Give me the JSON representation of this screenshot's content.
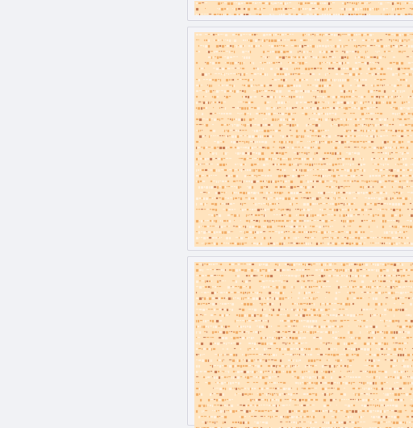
{
  "colors": {
    "page_background": "#f1f2f5",
    "card_background": "#f4f4f8",
    "card_border": "#d9d9e2",
    "tile_background": "#ffe3bd",
    "glyph_warm": "#f0a860",
    "glyph_rust": "#c0704a",
    "glyph_faint": "#fff3e3"
  },
  "cards": [
    {
      "name": "top-partial-card"
    },
    {
      "name": "middle-card"
    },
    {
      "name": "bottom-card"
    }
  ]
}
